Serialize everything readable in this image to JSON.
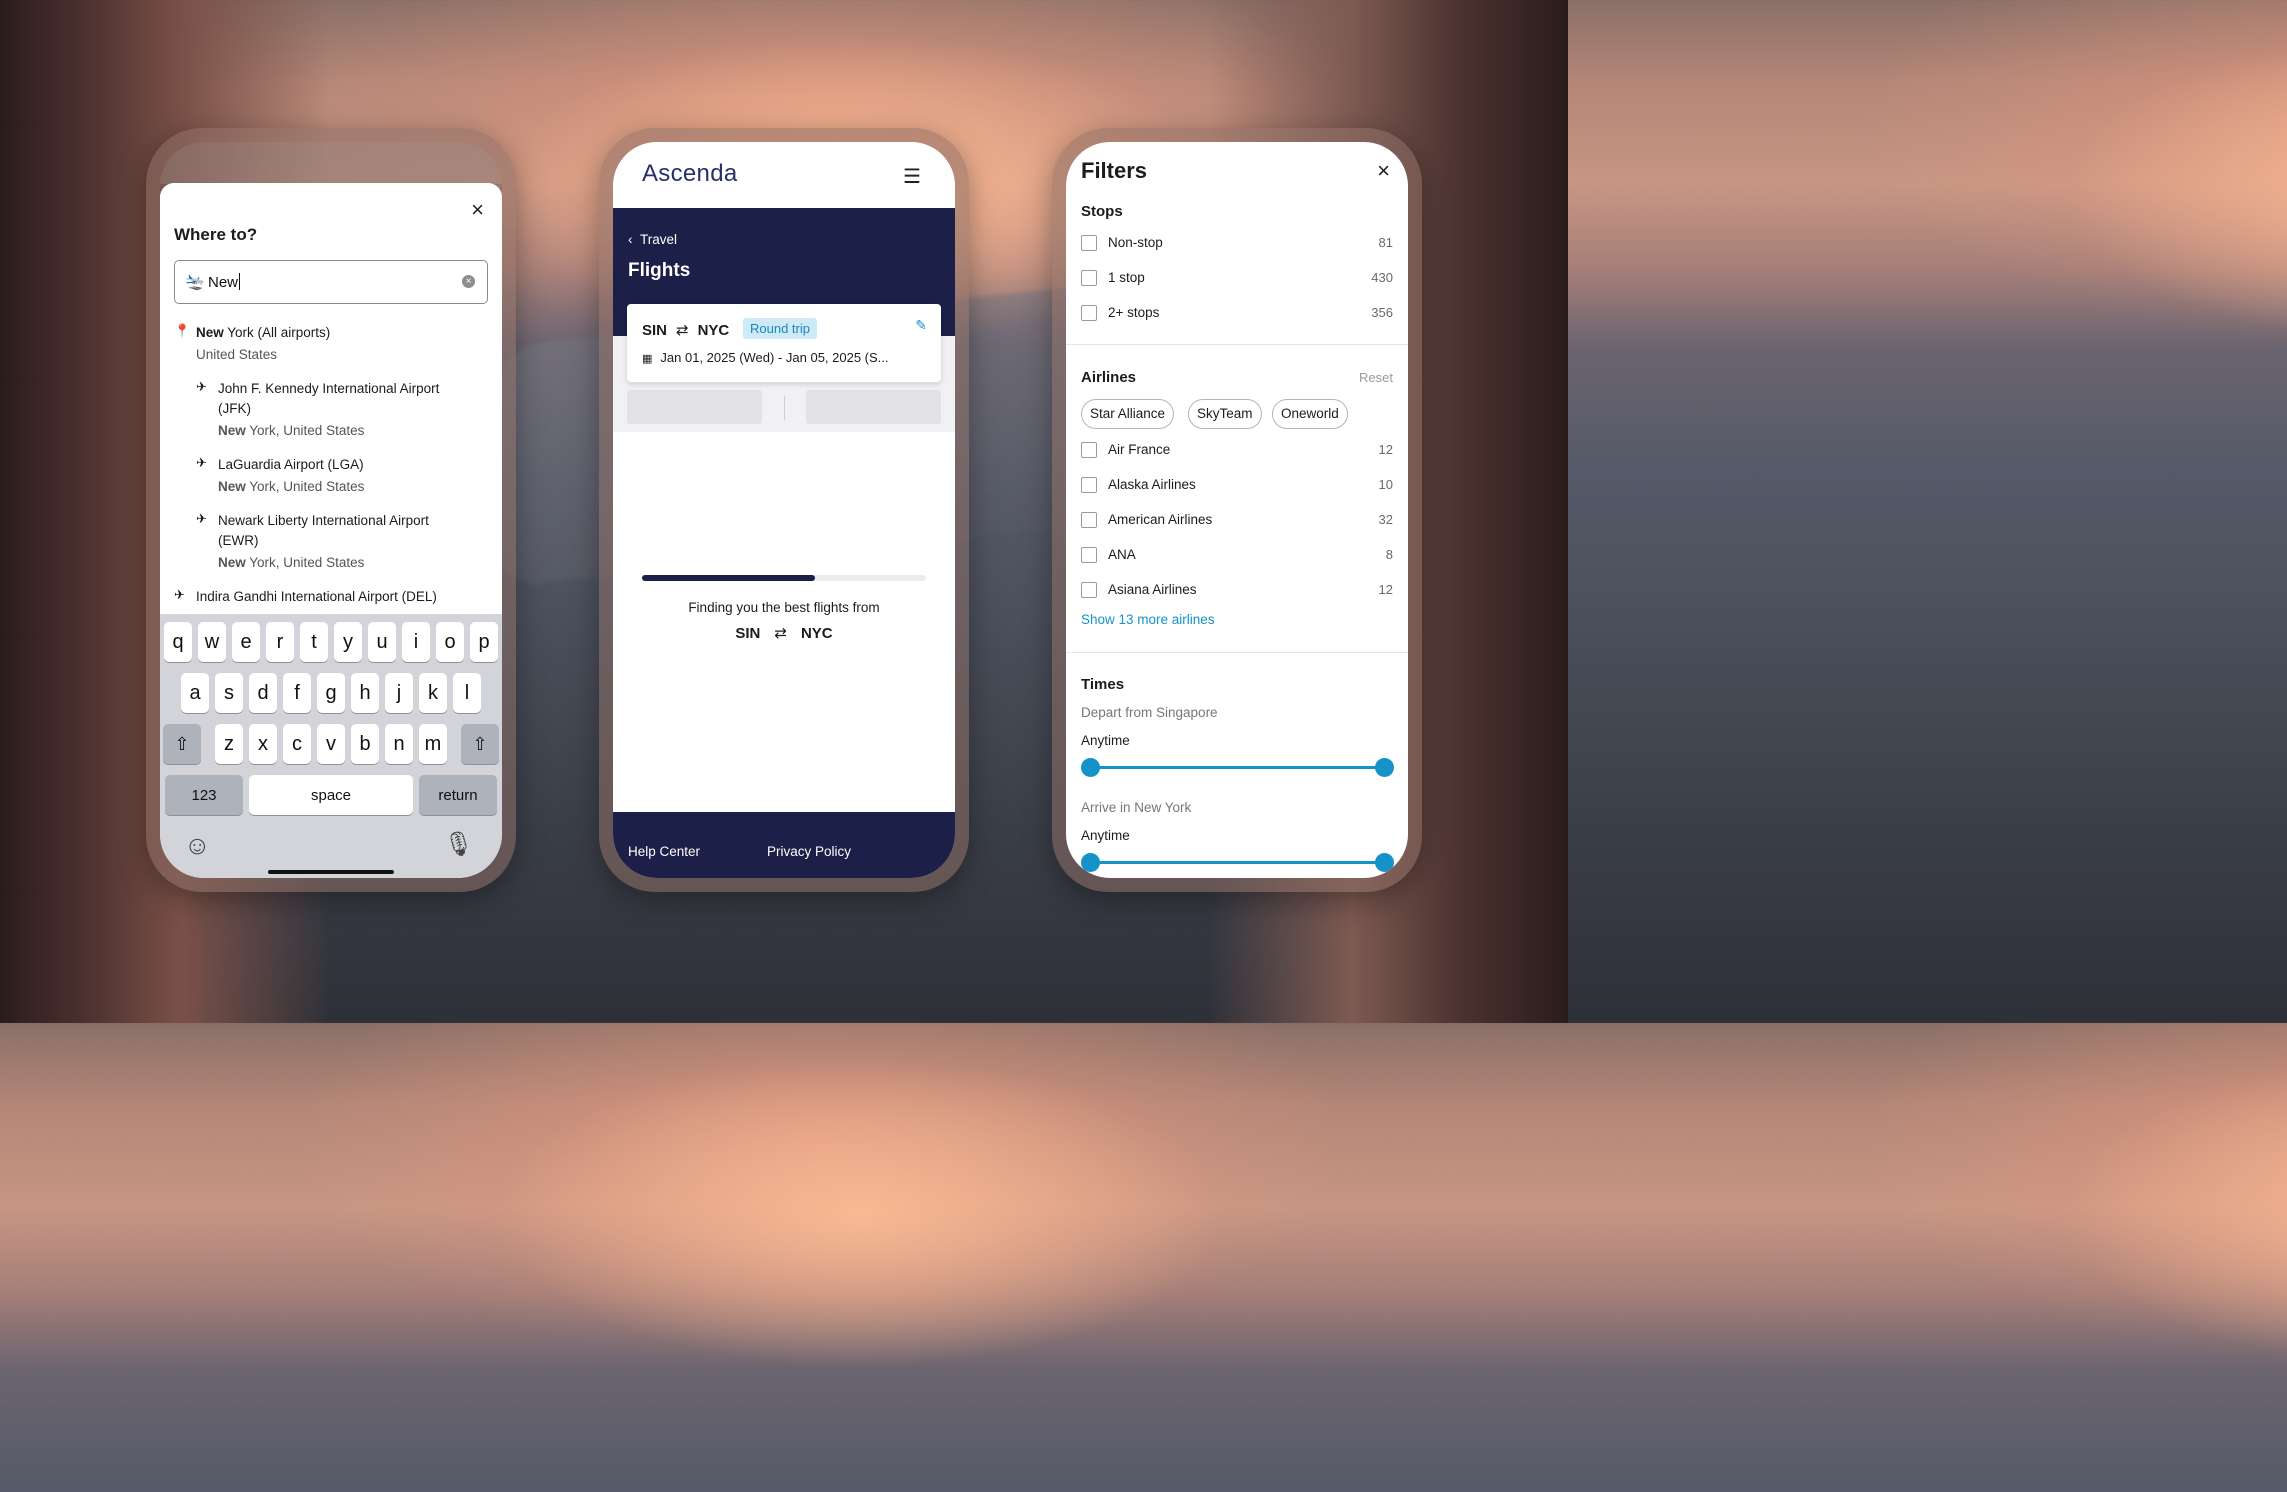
{
  "phone1": {
    "title": "Where to?",
    "close_icon": "close-icon",
    "search_value": "New",
    "results": [
      {
        "bold": "New",
        "rest": " York (All airports)",
        "sub": "United States",
        "indent": false,
        "icon": "location-pin-icon"
      },
      {
        "line1": "John F. Kennedy International Airport",
        "line2": "(JFK)",
        "bold": "New",
        "rest": " York, United States",
        "indent": true,
        "icon": "plane-icon"
      },
      {
        "line1": "LaGuardia Airport (LGA)",
        "bold": "New",
        "rest": " York, United States",
        "indent": true,
        "icon": "plane-icon"
      },
      {
        "line1": "Newark Liberty International Airport",
        "line2": "(EWR)",
        "bold": "New",
        "rest": " York, United States",
        "indent": true,
        "icon": "plane-icon"
      },
      {
        "line1": "Indira Gandhi International Airport (DEL)",
        "indent": false,
        "icon": "plane-icon"
      }
    ],
    "keyboard": {
      "row1": [
        "q",
        "w",
        "e",
        "r",
        "t",
        "y",
        "u",
        "i",
        "o",
        "p"
      ],
      "row2": [
        "a",
        "s",
        "d",
        "f",
        "g",
        "h",
        "j",
        "k",
        "l"
      ],
      "row3": [
        "z",
        "x",
        "c",
        "v",
        "b",
        "n",
        "m"
      ],
      "numbers": "123",
      "space": "space",
      "return": "return"
    }
  },
  "phone2": {
    "logo": "Ascenda",
    "breadcrumb": "Travel",
    "title": "Flights",
    "origin": "SIN",
    "destination": "NYC",
    "trip_type": "Round trip",
    "dates": "Jan 01, 2025 (Wed) - Jan 05, 2025 (S...",
    "progress": 0.61,
    "finding_text": "Finding you the best flights from",
    "footer": {
      "help": "Help Center",
      "privacy": "Privacy Policy"
    }
  },
  "phone3": {
    "title": "Filters",
    "stops": {
      "title": "Stops",
      "items": [
        {
          "label": "Non-stop",
          "count": "81"
        },
        {
          "label": "1 stop",
          "count": "430"
        },
        {
          "label": "2+ stops",
          "count": "356"
        }
      ]
    },
    "airlines": {
      "title": "Airlines",
      "reset": "Reset",
      "chips": [
        "Star Alliance",
        "SkyTeam",
        "Oneworld"
      ],
      "items": [
        {
          "label": "Air France",
          "count": "12"
        },
        {
          "label": "Alaska Airlines",
          "count": "10"
        },
        {
          "label": "American Airlines",
          "count": "32"
        },
        {
          "label": "ANA",
          "count": "8"
        },
        {
          "label": "Asiana Airlines",
          "count": "12"
        }
      ],
      "show_more": "Show 13 more airlines"
    },
    "times": {
      "title": "Times",
      "depart_label": "Depart from Singapore",
      "depart_value": "Anytime",
      "arrive_label": "Arrive in New York",
      "arrive_value": "Anytime"
    }
  },
  "colors": {
    "navy": "#1c1f47",
    "accent": "#1593c9",
    "badge_bg": "#cfeaf7"
  }
}
